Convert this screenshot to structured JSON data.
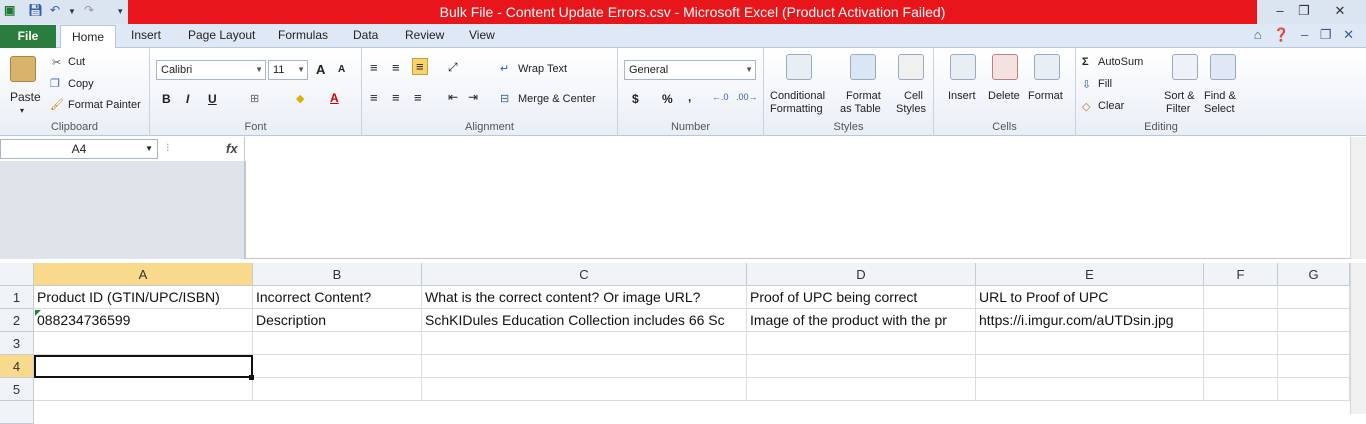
{
  "window": {
    "title": "Bulk File - Content Update Errors.csv - Microsoft Excel (Product Activation Failed)",
    "minimize": "–",
    "restore": "❐",
    "close": "✕"
  },
  "tabs": [
    "File",
    "Home",
    "Insert",
    "Page Layout",
    "Formulas",
    "Data",
    "Review",
    "View"
  ],
  "ribbon": {
    "clipboard": {
      "paste": "Paste",
      "cut": "Cut",
      "copy": "Copy",
      "format_painter": "Format Painter",
      "label": "Clipboard"
    },
    "font": {
      "name": "Calibri",
      "size": "11",
      "grow": "A",
      "shrink": "A",
      "bold": "B",
      "italic": "I",
      "underline": "U",
      "font_color": "A",
      "label": "Font"
    },
    "alignment": {
      "wrap_text": "Wrap Text",
      "merge_center": "Merge & Center",
      "label": "Alignment"
    },
    "number": {
      "format": "General",
      "currency": "$",
      "percent": "%",
      "comma": ",",
      "inc_dec": ".0\n.00",
      "dec_dec": ".00\n.0",
      "label": "Number"
    },
    "styles": {
      "conditional": "Conditional",
      "conditional2": "Formatting",
      "format_as": "Format",
      "format_as2": "as Table",
      "cell_styles": "Cell",
      "cell_styles2": "Styles",
      "label": "Styles"
    },
    "cells": {
      "insert": "Insert",
      "delete": "Delete",
      "format": "Format",
      "label": "Cells"
    },
    "editing": {
      "autosum": "AutoSum",
      "fill": "Fill",
      "clear": "Clear",
      "sort": "Sort &",
      "sort2": "Filter",
      "find": "Find &",
      "find2": "Select",
      "label": "Editing"
    }
  },
  "formula_bar": {
    "name_box": "A4",
    "fx": "fx",
    "value": ""
  },
  "grid": {
    "columns": [
      "A",
      "B",
      "C",
      "D",
      "E",
      "F",
      "G"
    ],
    "rows": [
      "1",
      "2",
      "3",
      "4",
      "5"
    ],
    "cells": {
      "r1": [
        "Product ID (GTIN/UPC/ISBN)",
        "Incorrect Content?",
        "What is the correct content? Or image URL?",
        "Proof of UPC being correct",
        "URL to Proof of UPC",
        "",
        ""
      ],
      "r2": [
        "088234736599",
        "Description",
        "SchKIDules Education Collection includes 66 Sc",
        "Image of the product with the pr",
        "https://i.imgur.com/aUTDsin.jpg",
        "",
        ""
      ]
    },
    "active_cell": "A4",
    "colors": {
      "active_header": "#f9d98b",
      "title_red": "#e8161a",
      "file_tab": "#2a7d3c"
    }
  }
}
